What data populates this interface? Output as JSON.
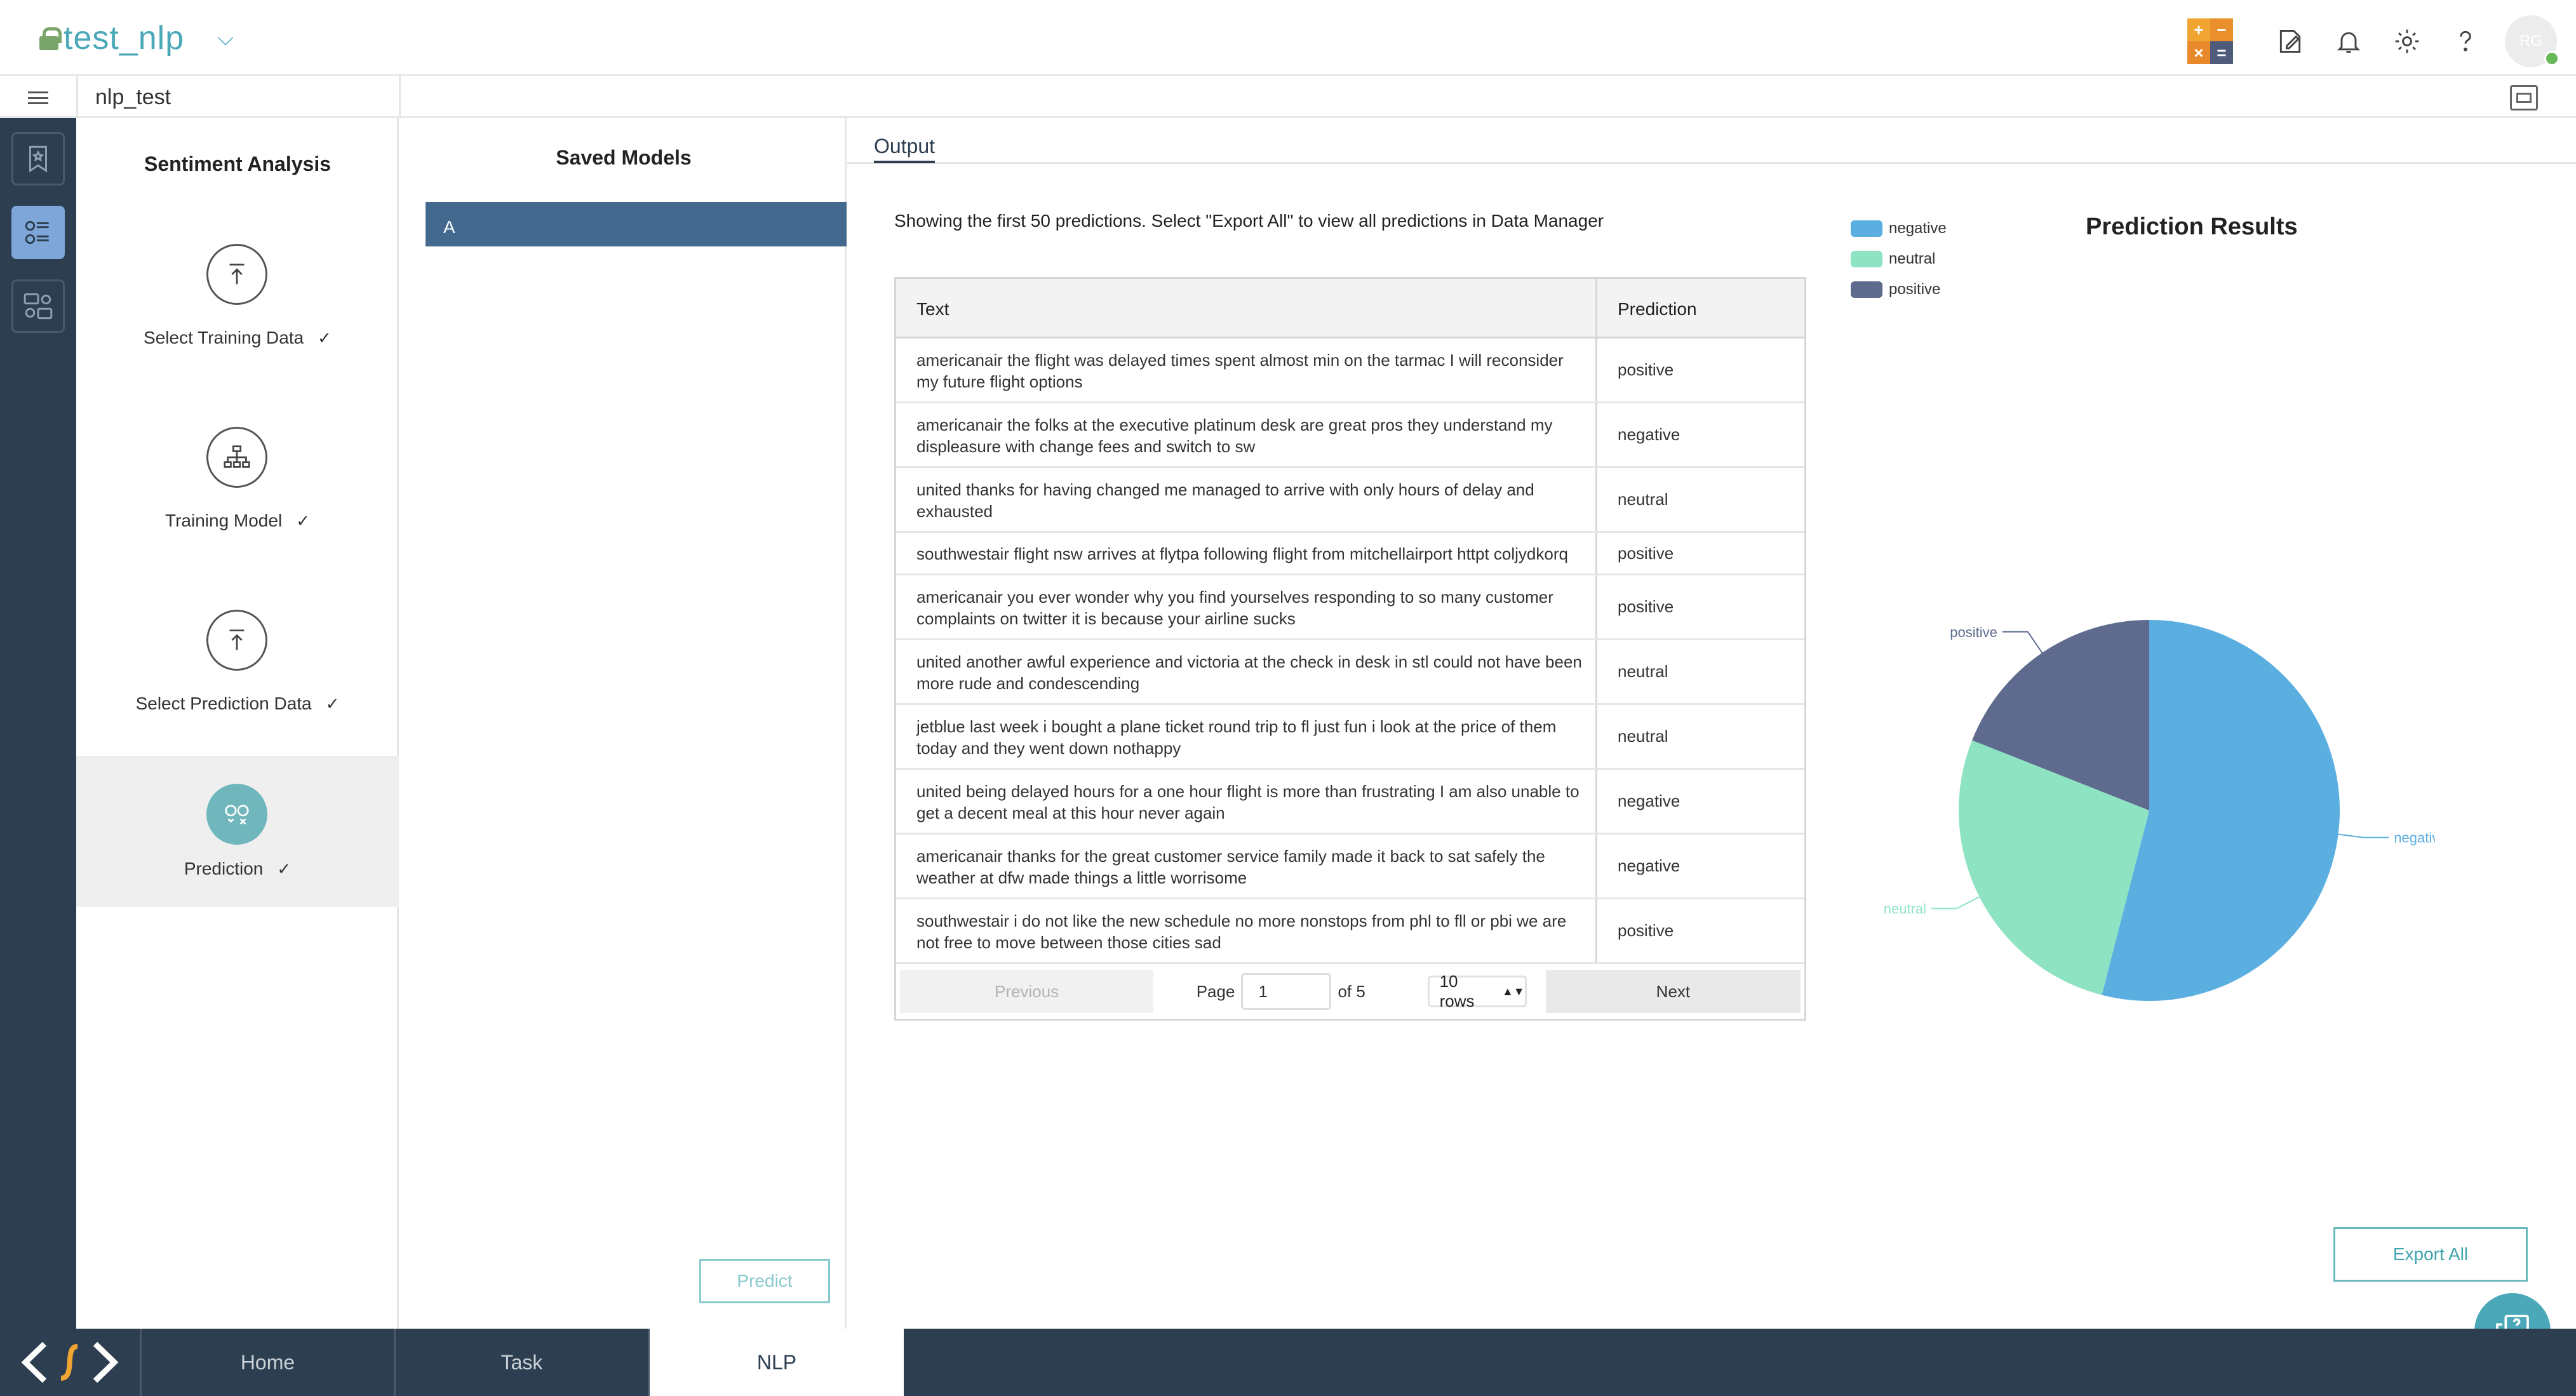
{
  "app": {
    "title": "test_nlp"
  },
  "subbar": {
    "breadcrumb": "nlp_test"
  },
  "topbar": {
    "calculator_glyphs": [
      "+",
      "−",
      "×",
      "="
    ],
    "avatar_initials": "RG"
  },
  "steps": {
    "title": "Sentiment Analysis",
    "items": [
      {
        "label": "Select Training Data",
        "check": "✓",
        "icon": "upload-icon"
      },
      {
        "label": "Training Model",
        "check": "✓",
        "icon": "hierarchy-icon"
      },
      {
        "label": "Select Prediction Data",
        "check": "✓",
        "icon": "upload-icon"
      },
      {
        "label": "Prediction",
        "check": "✓",
        "icon": "prediction-faces-icon",
        "active": true
      }
    ]
  },
  "models": {
    "title": "Saved Models",
    "items": [
      "A"
    ],
    "predict_label": "Predict"
  },
  "output": {
    "tab_label": "Output",
    "notice": "Showing the first 50 predictions. Select \"Export All\" to view all predictions in Data Manager",
    "table": {
      "headers": {
        "text": "Text",
        "prediction": "Prediction"
      },
      "rows": [
        {
          "text": "americanair the flight was delayed times spent almost min on the tarmac I will reconsider my future flight options",
          "prediction": "positive"
        },
        {
          "text": "americanair the folks at the executive platinum desk are great pros they understand my displeasure with change fees and switch to sw",
          "prediction": "negative"
        },
        {
          "text": "united thanks for having changed me managed to arrive with only hours of delay and exhausted",
          "prediction": "neutral"
        },
        {
          "text": "southwestair flight nsw arrives at flytpa following flight from mitchellairport httpt coljydkorq",
          "prediction": "positive"
        },
        {
          "text": "americanair you ever wonder why you find yourselves responding to so many customer complaints on twitter it is because your airline sucks",
          "prediction": "positive"
        },
        {
          "text": "united another awful experience and victoria at the check in desk in stl could not have been more rude and condescending",
          "prediction": "neutral"
        },
        {
          "text": "jetblue last week i bought a plane ticket round trip to fl just fun i look at the price of them today and they went down nothappy",
          "prediction": "neutral"
        },
        {
          "text": "united being delayed hours for a one hour flight is more than frustrating I am also unable to get a decent meal at this hour never again",
          "prediction": "negative"
        },
        {
          "text": "americanair thanks for the great customer service family made it back to sat safely the weather at dfw made things a little worrisome",
          "prediction": "negative"
        },
        {
          "text": "southwestair i do not like the new schedule no more nonstops from phl to fll or pbi we are not free to move between those cities sad",
          "prediction": "positive"
        }
      ]
    },
    "pager": {
      "previous": "Previous",
      "page_label": "Page",
      "page_value": "1",
      "of_label": "of 5",
      "rows_label": "10 rows",
      "next": "Next"
    },
    "export_label": "Export All"
  },
  "chart_data": {
    "type": "pie",
    "title": "Prediction Results",
    "legend_position": "top-left",
    "series": [
      {
        "name": "negative",
        "value": 54,
        "color": "#5aaee0"
      },
      {
        "name": "neutral",
        "value": 27,
        "color": "#8ee3c3"
      },
      {
        "name": "positive",
        "value": 19,
        "color": "#5e6b8e"
      }
    ]
  },
  "bottombar": {
    "tabs": [
      {
        "label": "Home"
      },
      {
        "label": "Task"
      },
      {
        "label": "NLP",
        "active": true
      }
    ]
  }
}
